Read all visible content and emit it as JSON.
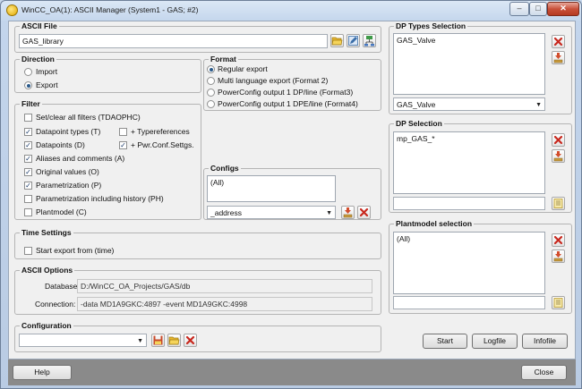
{
  "window": {
    "title": "WinCC_OA(1): ASCII Manager (System1 - GAS; #2)"
  },
  "ascii_file": {
    "title": "ASCII File",
    "value": "GAS_library"
  },
  "direction": {
    "title": "Direction",
    "options": [
      "Import",
      "Export"
    ],
    "selected": "Export"
  },
  "format": {
    "title": "Format",
    "options": [
      "Regular export",
      "Multi language export (Format 2)",
      "PowerConfig output 1 DP/line (Format3)",
      "PowerConfig output 1 DPE/line (Format4)"
    ],
    "selected": "Regular export"
  },
  "filter": {
    "title": "Filter",
    "set_clear": "Set/clear all filters (TDAOPHC)",
    "items": [
      {
        "label": "Datapoint types (T)",
        "checked": true
      },
      {
        "label": "Datapoints (D)",
        "checked": true
      },
      {
        "label": "Aliases and comments (A)",
        "checked": true
      },
      {
        "label": "Original values (O)",
        "checked": true
      },
      {
        "label": "Parametrization (P)",
        "checked": true
      },
      {
        "label": "Parametrization including history (PH)",
        "checked": false
      },
      {
        "label": "Plantmodel (C)",
        "checked": false
      }
    ],
    "typereferences": {
      "label": "+ Typereferences",
      "checked": false
    },
    "pwr_conf": {
      "label": "+ Pwr.Conf.Settgs.",
      "checked": true
    }
  },
  "configs": {
    "title": "Configs",
    "list": [
      "(All)"
    ],
    "combo_value": "_address"
  },
  "time_settings": {
    "title": "Time Settings",
    "start_export_label": "Start export from (time)"
  },
  "ascii_options": {
    "title": "ASCII Options",
    "database_label": "Database:",
    "database_value": "D:/WinCC_OA_Projects/GAS/db",
    "connection_label": "Connection:",
    "connection_value": "-data MD1A9GKC:4897 -event MD1A9GKC:4998"
  },
  "configuration": {
    "title": "Configuration",
    "combo_value": ""
  },
  "dp_types_selection": {
    "title": "DP Types Selection",
    "list": [
      "GAS_Valve"
    ],
    "combo_value": "GAS_Valve"
  },
  "dp_selection": {
    "title": "DP Selection",
    "list": [
      "mp_GAS_*"
    ],
    "input_value": ""
  },
  "plantmodel_selection": {
    "title": "Plantmodel selection",
    "list": [
      "(All)"
    ],
    "input_value": ""
  },
  "actions": {
    "start": "Start",
    "logfile": "Logfile",
    "infofile": "Infofile"
  },
  "footer": {
    "help": "Help",
    "close": "Close"
  },
  "icons": {
    "window": "wincc-app-icon",
    "folder": "folder-open-icon",
    "edit": "edit-icon",
    "tree": "tree-icon",
    "delete": "red-x-icon",
    "select": "select-list-icon",
    "save": "save-icon",
    "browse": "browse-icon"
  },
  "colors": {
    "delete": "#c8281e",
    "folder": "#e8b830",
    "accent": "#2a5a8a"
  }
}
